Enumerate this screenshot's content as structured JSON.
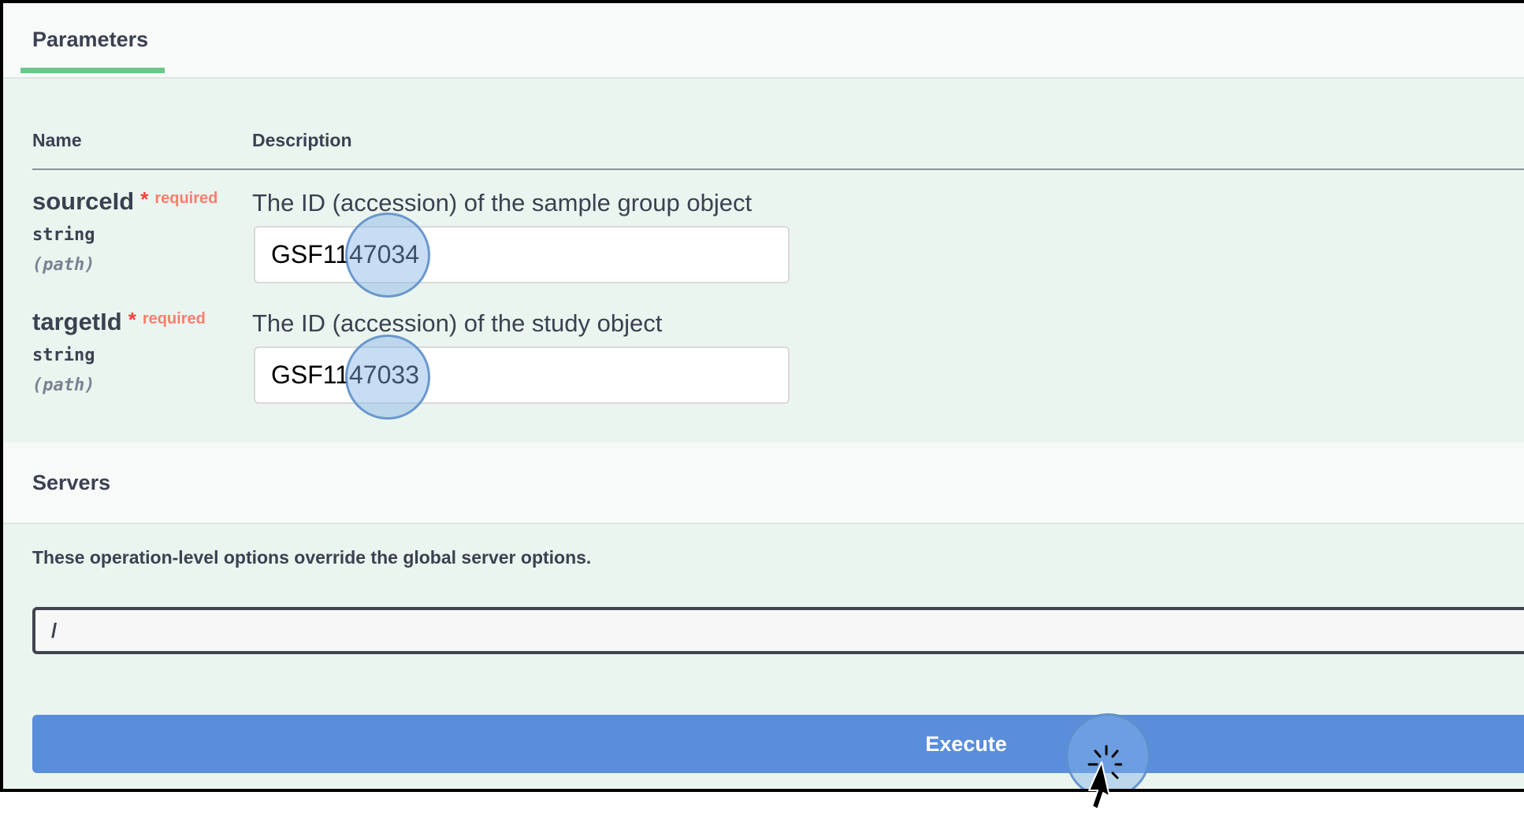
{
  "tabs": {
    "parameters_label": "Parameters"
  },
  "table": {
    "name_header": "Name",
    "description_header": "Description"
  },
  "parameters": [
    {
      "name": "sourceId",
      "star": "*",
      "required_label": "required",
      "type": "string",
      "location": "(path)",
      "description": "The ID (accession) of the sample group object",
      "value": "GSF1147034"
    },
    {
      "name": "targetId",
      "star": "*",
      "required_label": "required",
      "type": "string",
      "location": "(path)",
      "description": "The ID (accession) of the study object",
      "value": "GSF1147033"
    }
  ],
  "servers": {
    "title": "Servers",
    "note": "These operation-level options override the global server options.",
    "selected": "/"
  },
  "actions": {
    "execute_label": "Execute"
  },
  "colors": {
    "accent_green": "#6cc68c",
    "execute_blue": "#5a8ddc",
    "required_red": "#f93e3e",
    "panel_bg": "#ebf5ef"
  }
}
